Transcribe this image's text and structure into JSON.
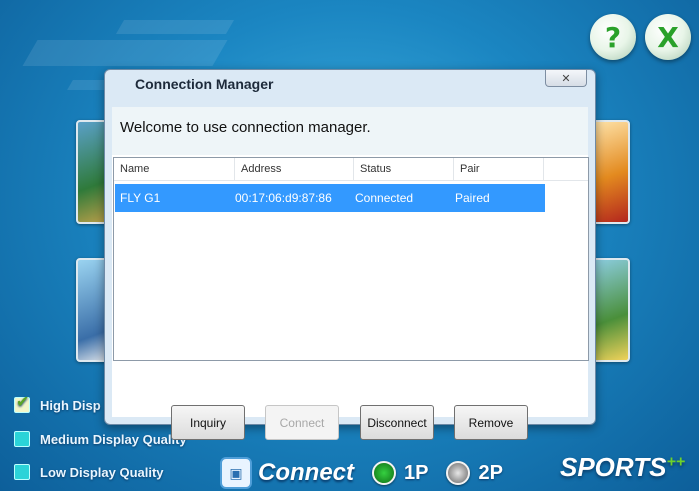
{
  "background": {
    "high_display_label": "High Disp",
    "medium_display_label": "Medium Display Quality",
    "low_display_label": "Low Display Quality",
    "connect_label": "Connect",
    "player1_label": "1P",
    "player2_label": "2P",
    "logo_text": "SPORTS",
    "logo_suffix": "++",
    "help_icon_glyph": "?",
    "close_icon_glyph": "X",
    "connect_icon_glyph": "▣",
    "check_glyph": "✔"
  },
  "dialog": {
    "title": "Connection Manager",
    "close_glyph": "✕",
    "welcome": "Welcome to use connection manager.",
    "columns": [
      "Name",
      "Address",
      "Status",
      "Pair"
    ],
    "rows": [
      {
        "name": "FLY G1",
        "address": "00:17:06:d9:87:86",
        "status": "Connected",
        "pair": "Paired",
        "selected": true
      }
    ],
    "buttons": {
      "inquiry": "Inquiry",
      "connect": "Connect",
      "disconnect": "Disconnect",
      "remove": "Remove"
    }
  },
  "colors": {
    "selection": "#3399ff",
    "player1_radio": "#1fa52a",
    "player2_radio": "#9a9a9a",
    "check_accent": "#5aa528"
  }
}
